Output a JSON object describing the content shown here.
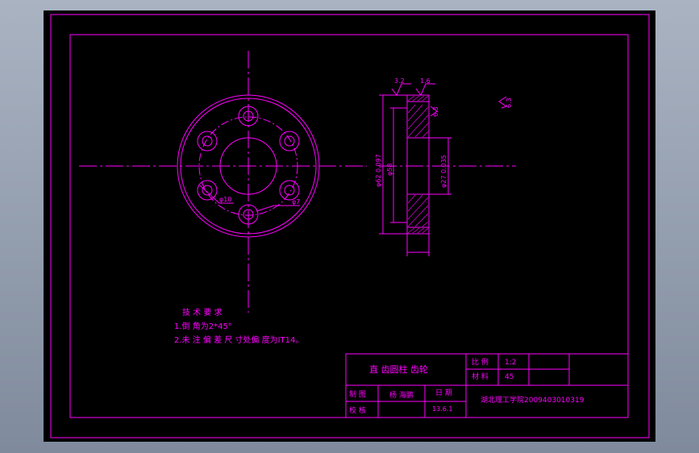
{
  "colors": {
    "background": "#000000",
    "line": "#ff00ff",
    "text": "#ff00ff",
    "highlight_text": "#ffffff",
    "frame_bg": "#9aa5b5"
  },
  "dimensions": {
    "surface_finish_top_left": "3.2",
    "surface_finish_top_right": "1.6",
    "surface_finish_side": "6.3",
    "surface_finish_general": "6.3",
    "outer_diameter": "φ62 0.097",
    "inner_diameter_left": "φ58",
    "bore_diameter": "φ27 0.035",
    "hole_diameter": "φ10",
    "small_hole_diameter": "φ7"
  },
  "tech_requirements": {
    "title": "技 术 要 求",
    "item1": "1.倒 角为2*45°",
    "item2": "2.未 注 偏 差 尺 寸处偏 度为IT14。"
  },
  "title_block": {
    "part_name": "直 齿圆柱 齿轮",
    "scale_label": "比 例",
    "scale_value": "1:2",
    "material_label": "材 料",
    "material_value": "45",
    "drawn_label": "制 图",
    "drawn_name": "杨 海鹏",
    "date_label": "日 期",
    "date_value": "13.6.1",
    "checked_label": "校 核",
    "school": "湖北理工学院2009403010319"
  }
}
